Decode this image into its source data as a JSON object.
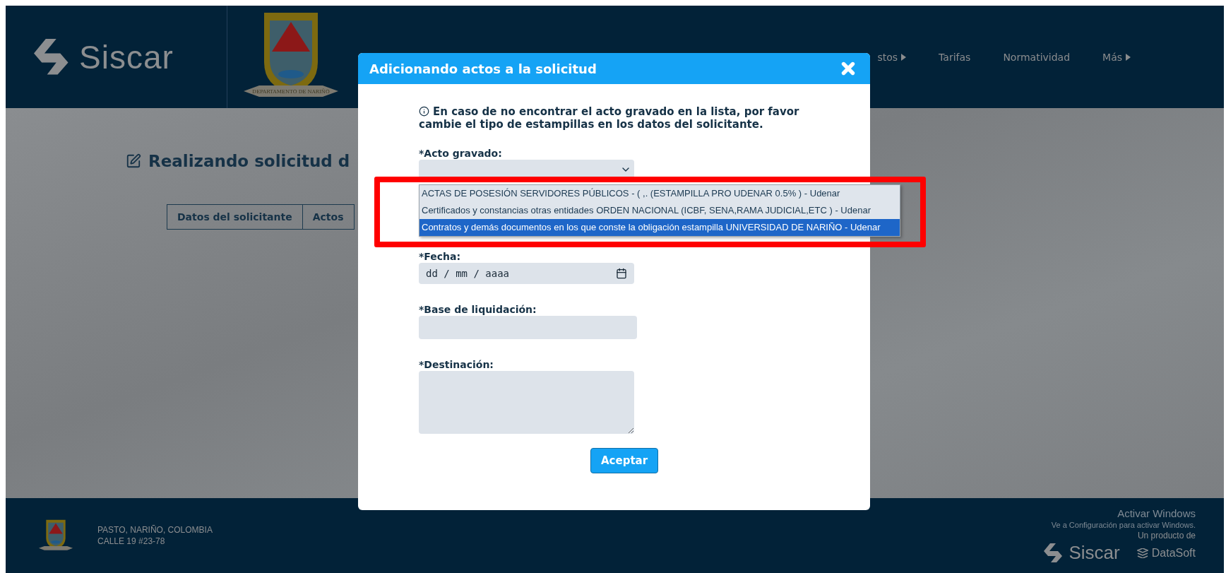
{
  "header": {
    "brand": "Siscar",
    "crest_ribbon": "DEPARTAMENTO DE NARIÑO",
    "nav": [
      {
        "label": "stos",
        "has_submenu": true
      },
      {
        "label": "Tarifas",
        "has_submenu": false
      },
      {
        "label": "Normatividad",
        "has_submenu": false
      },
      {
        "label": "Más",
        "has_submenu": true
      }
    ]
  },
  "page": {
    "title": "Realizando solicitud d",
    "tabs": [
      {
        "label": "Datos del solicitante",
        "selected": false
      },
      {
        "label": "Actos",
        "selected": false
      }
    ]
  },
  "modal": {
    "title": "Adicionando actos a la solicitud",
    "info": "En caso de no encontrar el acto gravado en la lista, por favor cambie el tipo de estampillas en los datos del solicitante.",
    "fields": [
      {
        "kind": "select",
        "label": "*Acto gravado:",
        "options": [
          {
            "label": "ACTAS DE POSESIÓN SERVIDORES PÚBLICOS - ( ,. (ESTAMPILLA PRO UDENAR 0.5% ) - Udenar",
            "selected": false
          },
          {
            "label": "Certificados y constancias otras entidades ORDEN NACIONAL (ICBF, SENA,RAMA JUDICIAL,ETC ) - Udenar",
            "selected": false
          },
          {
            "label": "Contratos y demás documentos en los que conste la obligación estampilla UNIVERSIDAD DE NARIÑO - Udenar",
            "selected": true
          }
        ]
      },
      {
        "kind": "date",
        "label": "*Fecha:",
        "placeholder": "dd / mm / aaaa"
      },
      {
        "kind": "text",
        "label": "*Base de liquidación:"
      },
      {
        "kind": "textarea",
        "label": "*Destinación:"
      }
    ],
    "button": "Aceptar"
  },
  "footer": {
    "address": [
      "PASTO, NARIÑO, COLOMBIA",
      "CALLE 19 #23-78"
    ],
    "windows_notice": [
      "Activar Windows",
      "Ve a Configuración para activar Windows."
    ],
    "credit": "Un producto de",
    "brand": "Siscar",
    "partner": "DataSoft"
  }
}
